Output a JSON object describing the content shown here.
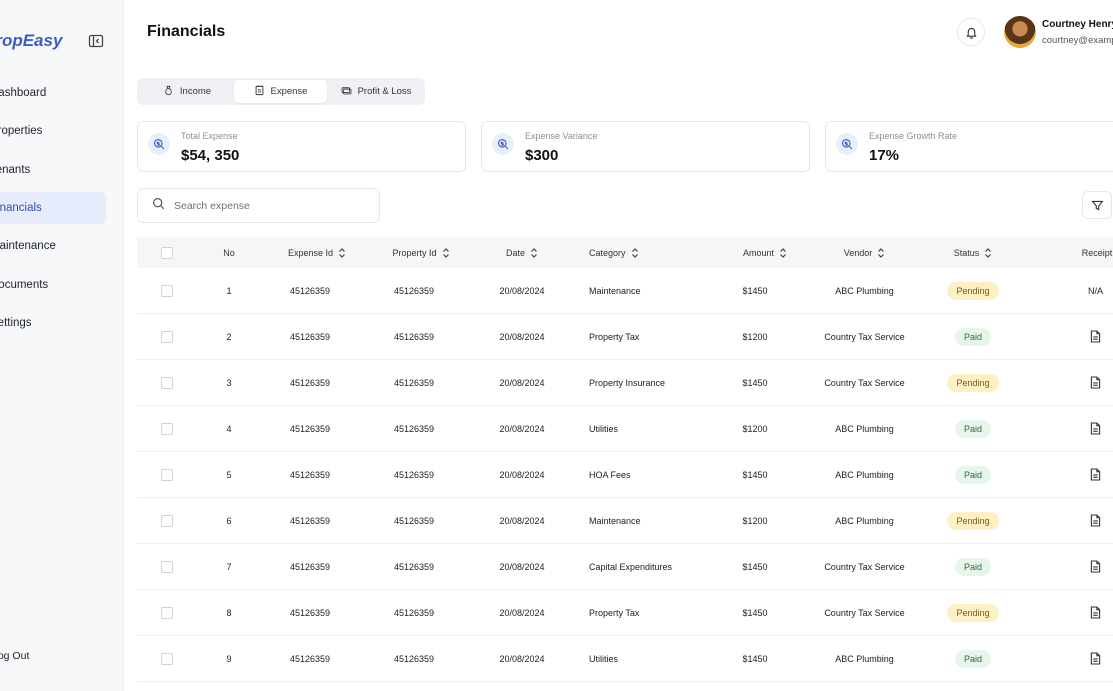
{
  "sidebar": {
    "brand": "PropEasy",
    "items": [
      {
        "label": "Dashboard",
        "active": false
      },
      {
        "label": "Properties",
        "active": false
      },
      {
        "label": "Tenants",
        "active": false
      },
      {
        "label": "Financials",
        "active": true
      },
      {
        "label": "Maintenance",
        "active": false
      },
      {
        "label": "Documents",
        "active": false
      },
      {
        "label": "Settings",
        "active": false
      }
    ],
    "logout": "Log Out"
  },
  "header": {
    "title": "Financials",
    "user": {
      "name": "Courtney Henry",
      "email": "courtney@example.com"
    }
  },
  "tabs": [
    {
      "label": "Income",
      "icon": "money-bag-icon",
      "active": false
    },
    {
      "label": "Expense",
      "icon": "receipt-icon",
      "active": true
    },
    {
      "label": "Profit & Loss",
      "icon": "cash-icon",
      "active": false
    }
  ],
  "stats": [
    {
      "label": "Total Expense",
      "value": "$54, 350"
    },
    {
      "label": "Expense Variance",
      "value": "$300"
    },
    {
      "label": "Expense Growth Rate",
      "value": "17%"
    }
  ],
  "search": {
    "placeholder": "Search expense"
  },
  "table": {
    "columns": [
      "No",
      "Expense Id",
      "Property Id",
      "Date",
      "Category",
      "Amount",
      "Vendor",
      "Status",
      "Receipt"
    ],
    "rows": [
      {
        "no": "1",
        "expense_id": "45126359",
        "property_id": "45126359",
        "date": "20/08/2024",
        "category": "Maintenance",
        "amount": "$1450",
        "vendor": "ABC Plumbing",
        "status": "Pending",
        "receipt": "N/A"
      },
      {
        "no": "2",
        "expense_id": "45126359",
        "property_id": "45126359",
        "date": "20/08/2024",
        "category": "Property Tax",
        "amount": "$1200",
        "vendor": "Country Tax Service",
        "status": "Paid",
        "receipt": "document-icon"
      },
      {
        "no": "3",
        "expense_id": "45126359",
        "property_id": "45126359",
        "date": "20/08/2024",
        "category": "Property Insurance",
        "amount": "$1450",
        "vendor": "Country Tax Service",
        "status": "Pending",
        "receipt": "document-icon"
      },
      {
        "no": "4",
        "expense_id": "45126359",
        "property_id": "45126359",
        "date": "20/08/2024",
        "category": "Utilities",
        "amount": "$1200",
        "vendor": "ABC Plumbing",
        "status": "Paid",
        "receipt": "document-icon"
      },
      {
        "no": "5",
        "expense_id": "45126359",
        "property_id": "45126359",
        "date": "20/08/2024",
        "category": "HOA Fees",
        "amount": "$1450",
        "vendor": "ABC Plumbing",
        "status": "Paid",
        "receipt": "document-icon"
      },
      {
        "no": "6",
        "expense_id": "45126359",
        "property_id": "45126359",
        "date": "20/08/2024",
        "category": "Maintenance",
        "amount": "$1200",
        "vendor": "ABC Plumbing",
        "status": "Pending",
        "receipt": "document-icon"
      },
      {
        "no": "7",
        "expense_id": "45126359",
        "property_id": "45126359",
        "date": "20/08/2024",
        "category": "Capital Expenditures",
        "amount": "$1450",
        "vendor": "Country Tax Service",
        "status": "Paid",
        "receipt": "document-icon"
      },
      {
        "no": "8",
        "expense_id": "45126359",
        "property_id": "45126359",
        "date": "20/08/2024",
        "category": "Property Tax",
        "amount": "$1450",
        "vendor": "Country Tax Service",
        "status": "Pending",
        "receipt": "document-icon"
      },
      {
        "no": "9",
        "expense_id": "45126359",
        "property_id": "45126359",
        "date": "20/08/2024",
        "category": "Utilities",
        "amount": "$1450",
        "vendor": "ABC Plumbing",
        "status": "Paid",
        "receipt": "document-icon"
      }
    ]
  },
  "colors": {
    "accent": "#3b5cc4",
    "active_nav_bg": "#e6ecfb",
    "pending_bg": "#fdf0c4",
    "paid_bg": "#e7f6ea"
  }
}
